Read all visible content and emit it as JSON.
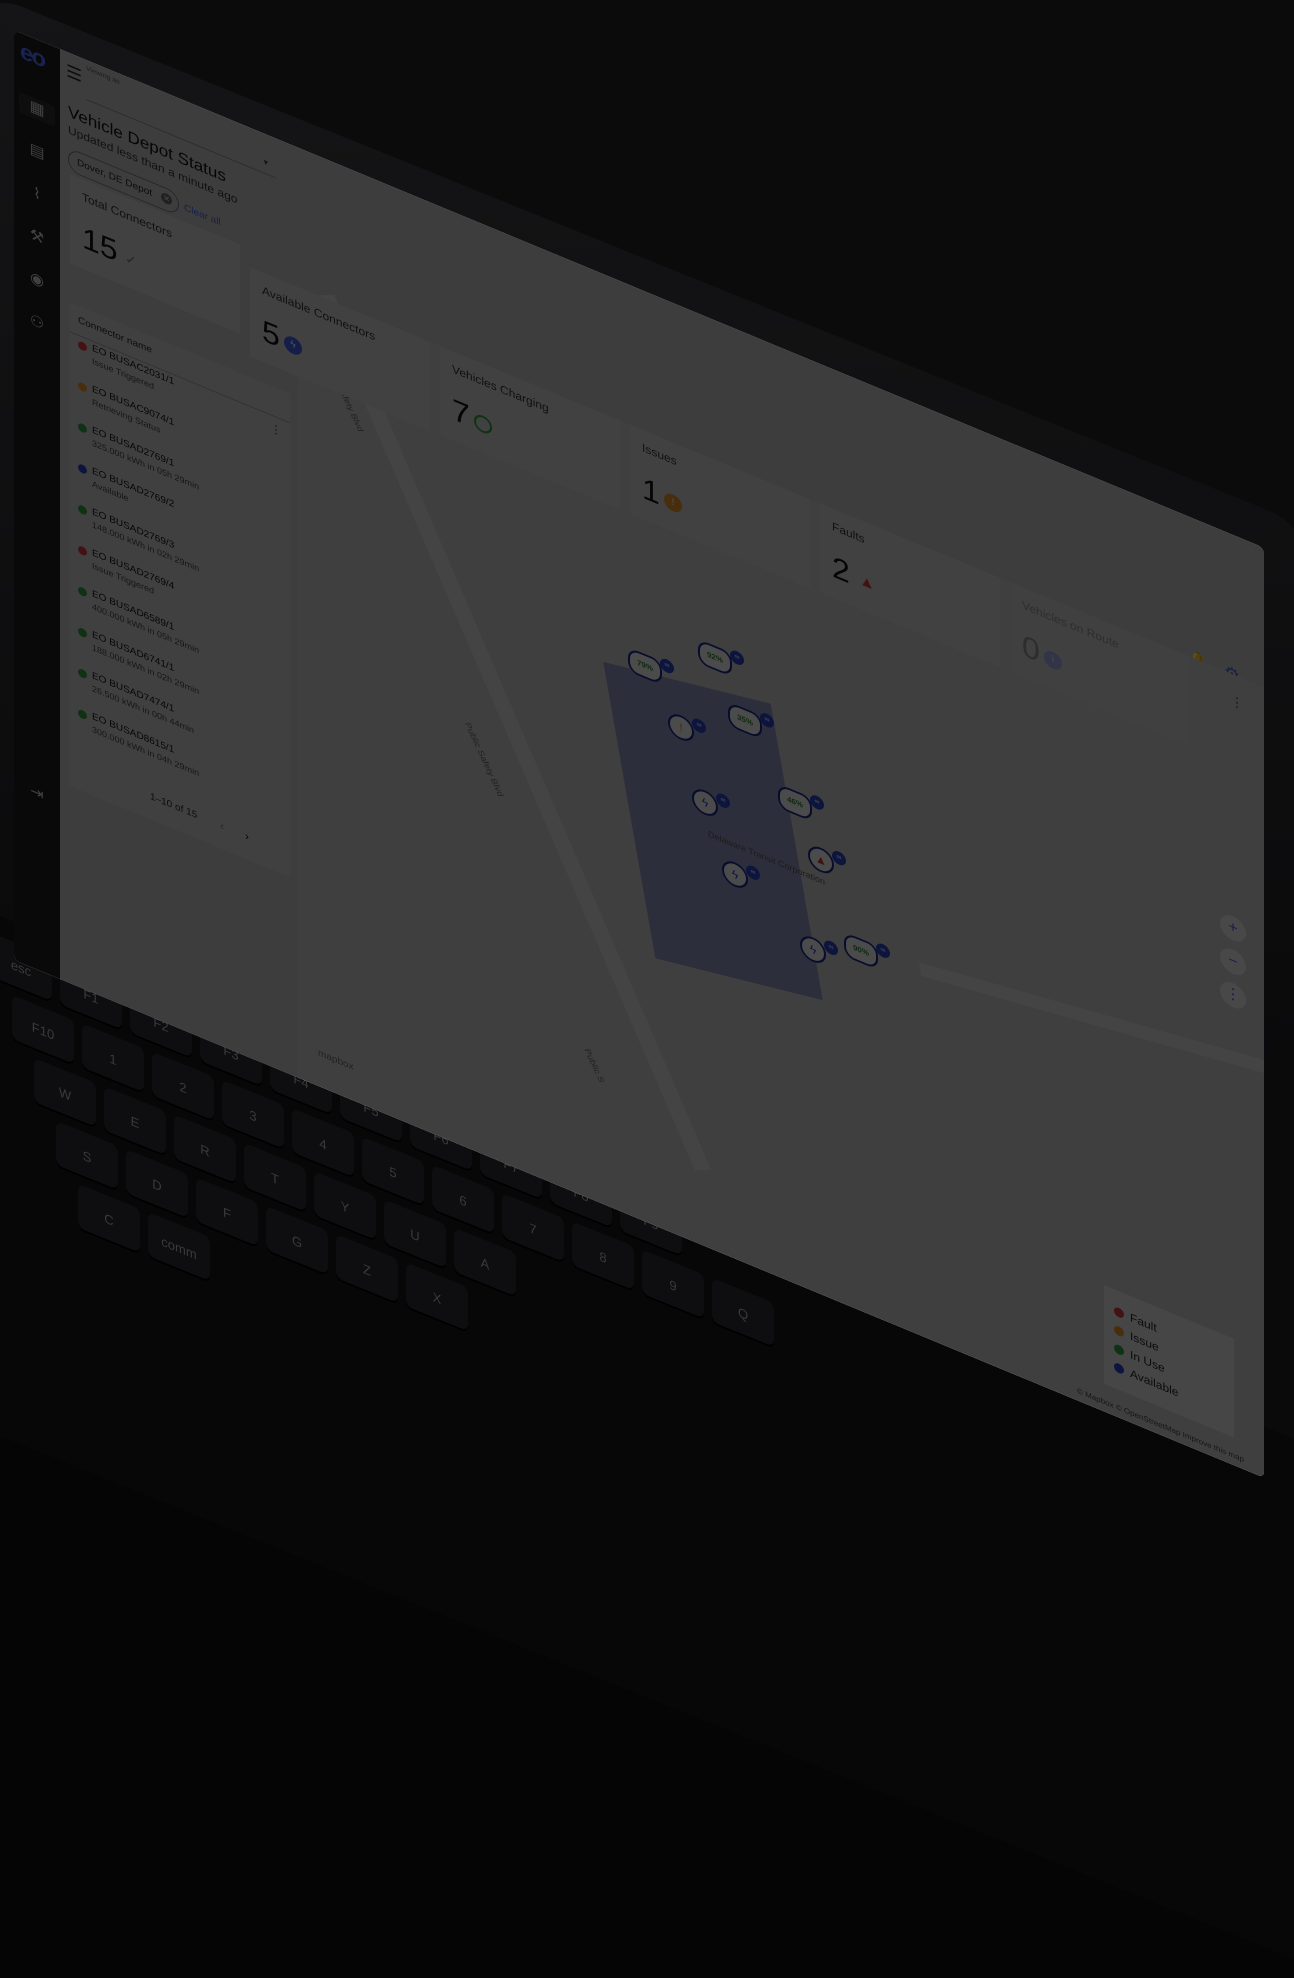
{
  "app": {
    "logo": "eo",
    "viewing_label": "Viewing as",
    "title": "Vehicle Depot Status",
    "subtitle": "Updated less than a minute ago",
    "filter_chip": "Dover, DE Depot",
    "clear_all": "Clear all"
  },
  "sidebar": {
    "icons": [
      "dashboard-icon",
      "document-icon",
      "analytics-icon",
      "wrench-icon",
      "signal-icon",
      "users-icon",
      "logout-icon"
    ]
  },
  "stats": [
    {
      "label": "Total Connectors",
      "value": "15",
      "icon": "check-icon",
      "color": "#888888"
    },
    {
      "label": "Available Connectors",
      "value": "5",
      "icon": "bolt-icon",
      "color": "#3f5fe0"
    },
    {
      "label": "Vehicles Charging",
      "value": "7",
      "icon": "circle-icon",
      "color": "#2f9a3f"
    },
    {
      "label": "Issues",
      "value": "1",
      "icon": "issue-icon",
      "color": "#e0902a"
    },
    {
      "label": "Faults",
      "value": "2",
      "icon": "warning-icon",
      "color": "#d03a3a"
    },
    {
      "label": "Vehicles on Route",
      "value": "0",
      "icon": "info-icon",
      "color": "#5f7fe0"
    }
  ],
  "connector_list": {
    "header": "Connector name",
    "rows": [
      {
        "name": "EO BUSAC2031/1",
        "status": "Issue Triggered",
        "color": "#d03a3a"
      },
      {
        "name": "EO BUSAC9074/1",
        "status": "Retrieving Status",
        "color": "#e0902a"
      },
      {
        "name": "EO BUSAD2769/1",
        "status": "325.000 kWh in 05h 29min",
        "color": "#2f9a3f"
      },
      {
        "name": "EO BUSAD2769/2",
        "status": "Available",
        "color": "#2a3fbf"
      },
      {
        "name": "EO BUSAD2769/3",
        "status": "148.000 kWh in 02h 29min",
        "color": "#2f9a3f"
      },
      {
        "name": "EO BUSAD2769/4",
        "status": "Issue Triggered",
        "color": "#d03a3a"
      },
      {
        "name": "EO BUSAD6589/1",
        "status": "400.000 kWh in 05h 29min",
        "color": "#2f9a3f"
      },
      {
        "name": "EO BUSAD6741/1",
        "status": "188.000 kWh in 02h 29min",
        "color": "#2f9a3f"
      },
      {
        "name": "EO BUSAD7474/1",
        "status": "26.500 kWh in 00h 44min",
        "color": "#2f9a3f"
      },
      {
        "name": "EO BUSAD8615/1",
        "status": "300.000 kWh in 04h 29min",
        "color": "#2f9a3f"
      }
    ],
    "pagination": "1–10 of 15"
  },
  "map": {
    "road_labels": [
      "Public Safety Blvd",
      "Public Safety Blvd",
      "Public S"
    ],
    "building_label": "Delaware Transit Corporation",
    "pins": [
      "79%",
      "92%",
      "35%",
      "46%",
      "90%"
    ],
    "mapbox_logo": "mapbox",
    "attribution": "© Mapbox © OpenStreetMap  Improve this map",
    "legend": [
      {
        "label": "Fault",
        "color": "#d03a3a"
      },
      {
        "label": "Issue",
        "color": "#e0902a"
      },
      {
        "label": "In Use",
        "color": "#2f9a3f"
      },
      {
        "label": "Available",
        "color": "#2a3fbf"
      }
    ]
  },
  "keyboard": {
    "keys": [
      "esc",
      "F1",
      "F2",
      "F3",
      "F4",
      "F5",
      "F6",
      "F7",
      "F8",
      "F9",
      "F10",
      "1",
      "2",
      "3",
      "4",
      "5",
      "6",
      "7",
      "8",
      "9",
      "Q",
      "W",
      "E",
      "R",
      "T",
      "Y",
      "U",
      "A",
      "S",
      "D",
      "F",
      "G",
      "Z",
      "X",
      "C",
      "comm"
    ]
  }
}
